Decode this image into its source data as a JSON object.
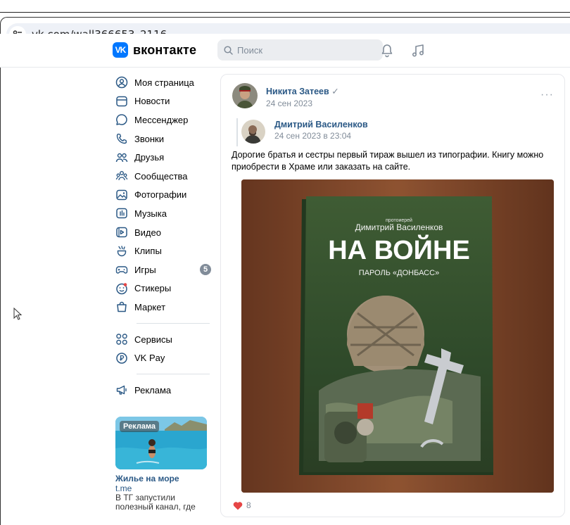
{
  "browser": {
    "url": "vk.com/wall366653_2116"
  },
  "header": {
    "logo_text": "вконтакте",
    "logo_mark": "VK",
    "search_placeholder": "Поиск",
    "icons": [
      "bell-icon",
      "music-icon"
    ]
  },
  "sidebar": {
    "items": [
      {
        "label": "Моя страница",
        "icon": "profile-icon"
      },
      {
        "label": "Новости",
        "icon": "news-icon"
      },
      {
        "label": "Мессенджер",
        "icon": "messenger-icon"
      },
      {
        "label": "Звонки",
        "icon": "phone-icon"
      },
      {
        "label": "Друзья",
        "icon": "friends-icon"
      },
      {
        "label": "Сообщества",
        "icon": "communities-icon"
      },
      {
        "label": "Фотографии",
        "icon": "photos-icon"
      },
      {
        "label": "Музыка",
        "icon": "music-icon"
      },
      {
        "label": "Видео",
        "icon": "video-icon"
      },
      {
        "label": "Клипы",
        "icon": "clips-icon"
      },
      {
        "label": "Игры",
        "icon": "games-icon",
        "badge": "5"
      },
      {
        "label": "Стикеры",
        "icon": "stickers-icon"
      },
      {
        "label": "Маркет",
        "icon": "market-icon"
      }
    ],
    "secondary": [
      {
        "label": "Сервисы",
        "icon": "services-icon"
      },
      {
        "label": "VK Pay",
        "icon": "vkpay-icon"
      }
    ],
    "tertiary": [
      {
        "label": "Реклама",
        "icon": "megaphone-icon"
      }
    ],
    "ad": {
      "badge": "Реклама",
      "title": "Жилье на море",
      "domain": "t.me",
      "text_line1": "В ТГ запустили",
      "text_line2": "полезный канал, где"
    }
  },
  "post": {
    "author": "Никита Затеев",
    "verified": "✓",
    "date": "24 сен 2023",
    "more": "···",
    "repost": {
      "author": "Дмитрий Василенков",
      "date": "24 сен 2023 в 23:04"
    },
    "text": "Дорогие братья и сестры первый тираж вышел из типографии. Книгу можно приобрести в Храме или заказать на сайте.",
    "image": {
      "book_kicker": "протоиерей",
      "book_author": "Димитрий Василенков",
      "book_title": "НА ВОЙНЕ",
      "book_subtitle": "ПАРОЛЬ «ДОНБАСС»"
    },
    "likes": "8"
  },
  "colors": {
    "accent": "#0077ff",
    "link": "#2a5885",
    "muted": "#818c99",
    "like": "#e64646"
  }
}
